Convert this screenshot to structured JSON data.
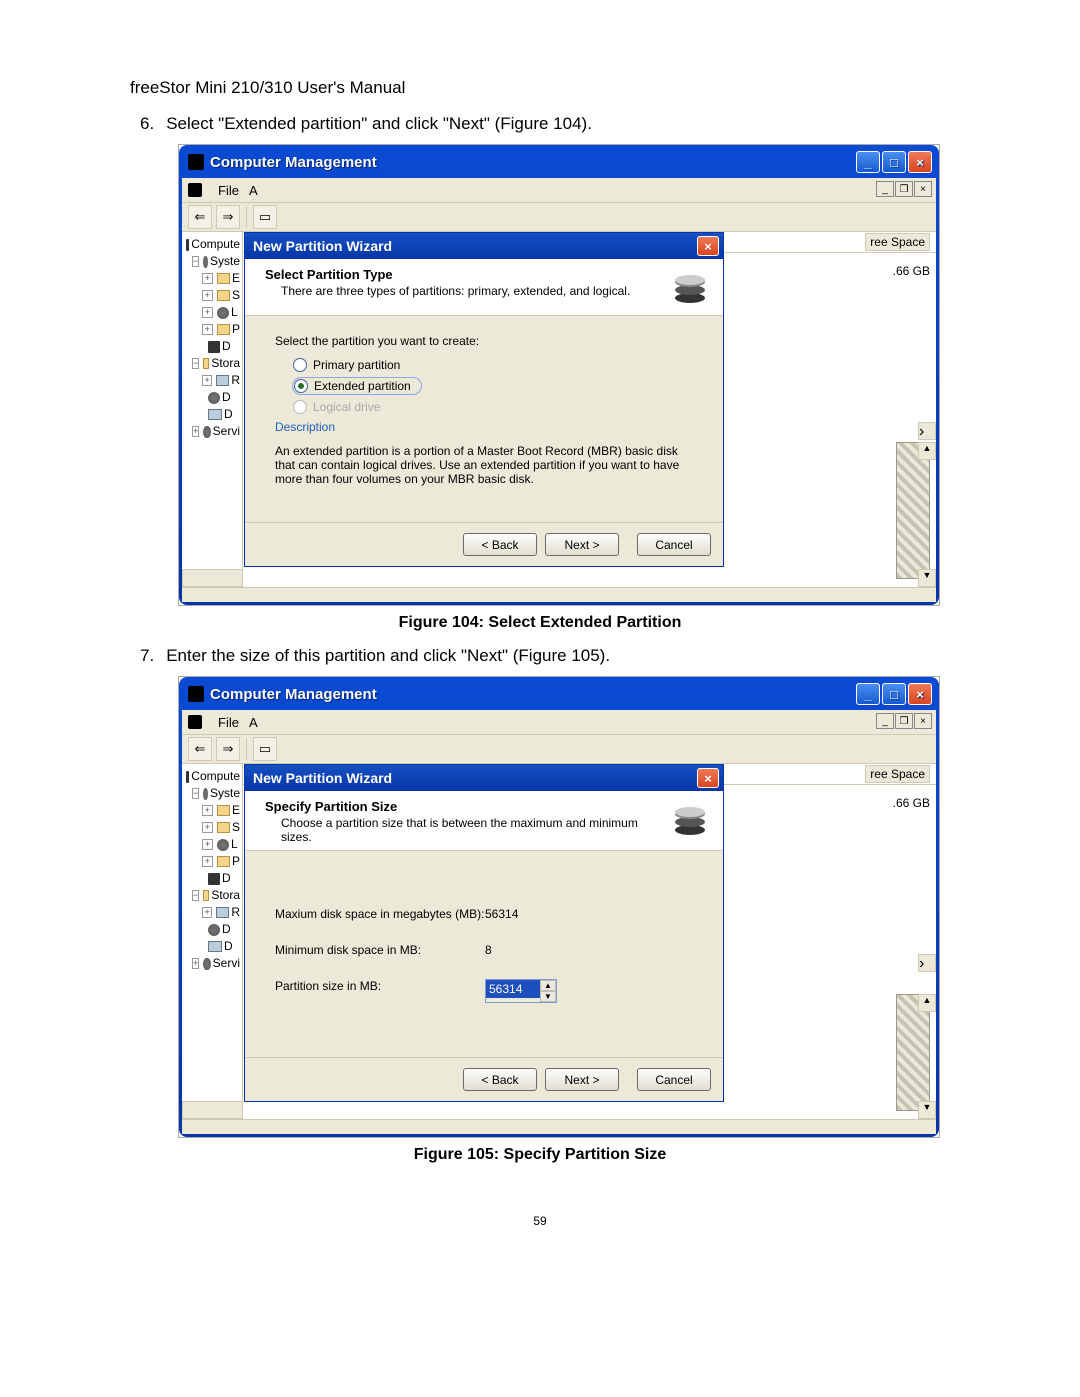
{
  "doc": {
    "header": "freeStor Mini 210/310 User's Manual",
    "page_number": "59",
    "step6_num": "6.",
    "step6_text": "Select \"Extended partition\" and click \"Next\" (Figure 104).",
    "step7_num": "7.",
    "step7_text": "Enter the size of this partition and click \"Next\" (Figure 105).",
    "fig104_caption": "Figure 104: Select Extended Partition",
    "fig105_caption": "Figure 105: Specify Partition Size"
  },
  "window": {
    "title": "Computer Management",
    "menubar": {
      "file": "File",
      "a_trunc": "A"
    },
    "tree": {
      "computer": "Compute",
      "system": "Syste",
      "e": "E",
      "s": "S",
      "l": "L",
      "p": "P",
      "d": "D",
      "stora": "Stora",
      "r": "R",
      "d2": "D",
      "d3": "D",
      "services": "Servi"
    },
    "right": {
      "free_space": "ree Space",
      "size": ".66 GB"
    }
  },
  "dlg1": {
    "title": "New Partition Wizard",
    "head_title": "Select Partition Type",
    "head_sub": "There are three types of partitions: primary, extended, and logical.",
    "prompt": "Select the partition you want to create:",
    "opt_primary": "Primary partition",
    "opt_extended": "Extended partition",
    "opt_logical": "Logical drive",
    "desc_label": "Description",
    "desc_text": "An extended partition is a portion of a Master Boot Record (MBR) basic disk that can contain logical drives. Use an extended partition if you want to have more than four volumes on your MBR basic disk.",
    "back": "< Back",
    "next": "Next >",
    "cancel": "Cancel"
  },
  "dlg2": {
    "title": "New Partition Wizard",
    "head_title": "Specify Partition Size",
    "head_sub": "Choose a partition size that is between the maximum and minimum sizes.",
    "max_label": "Maxium disk space in megabytes (MB):",
    "max_value": "56314",
    "min_label": "Minimum disk space in MB:",
    "min_value": "8",
    "size_label": "Partition size in MB:",
    "size_value": "56314",
    "back": "< Back",
    "next": "Next >",
    "cancel": "Cancel"
  }
}
